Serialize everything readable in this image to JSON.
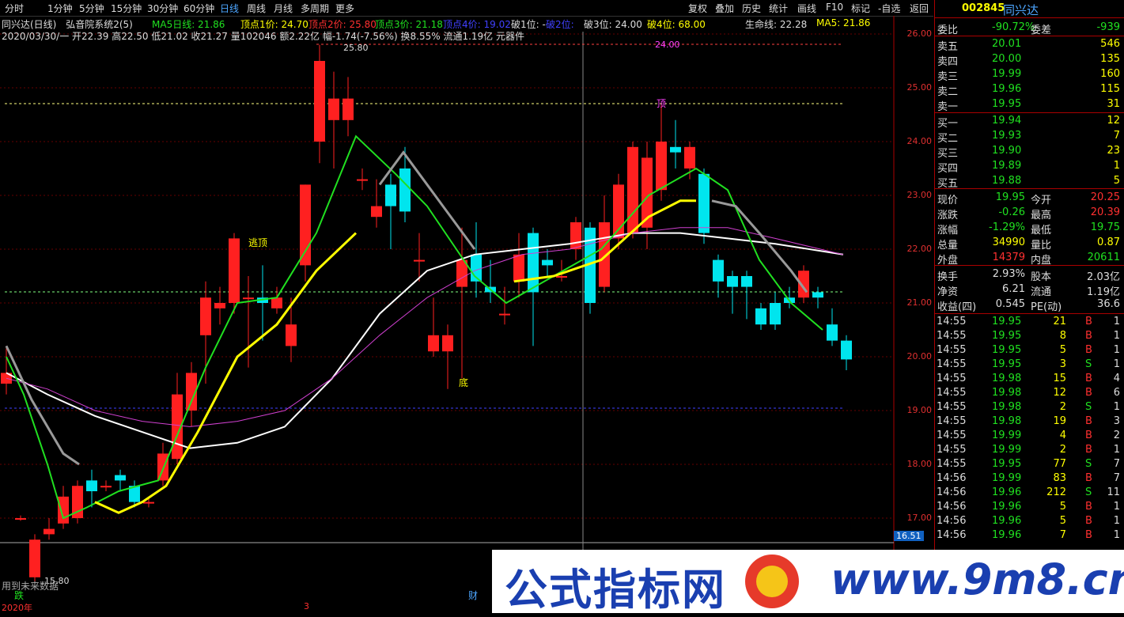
{
  "toolbar": {
    "tabs": [
      "分时",
      "1分钟",
      "5分钟",
      "15分钟",
      "30分钟",
      "60分钟",
      "日线",
      "周线",
      "月线",
      "多周期",
      "更多"
    ],
    "active": "日线",
    "right_buttons": [
      "复权",
      "叠加",
      "历史",
      "统计",
      "画线",
      "F10",
      "标记",
      "-自选",
      "返回"
    ]
  },
  "chart_header": {
    "title": "同兴达(日线)",
    "indicator": "弘音院系统2(5)",
    "ma5": "MA5日线: 21.86",
    "top1": "顶点1价: 24.70",
    "top2": "顶点2价: 25.80",
    "top3": "顶点3价: 21.18",
    "top4": "顶点4价: 19.02",
    "break1": "破1位: -",
    "break2": "破2位:",
    "break3": "破3位: 24.00",
    "break4": "破4位: 68.00",
    "lifeline": "生命线: 22.28",
    "ma5b": "MA5: 21.86"
  },
  "quote_line": "2020/03/30/一 开22.39 高22.50 低21.02 收21.27 量102046 额2.22亿 幅-1.74(-7.56%) 换8.55% 流通1.19亿 元器件",
  "chart_labels": {
    "escape_top": "逃顶",
    "bottom": "底",
    "high": "25.80",
    "low": "15.80",
    "top_mark": "顶",
    "current_price_tag": "16.51",
    "future_note": "用到未来数据",
    "x_year": "2020年",
    "x_month": "3",
    "die_tag": "跌",
    "cai_tag": "财",
    "top_price_mark": "24.00"
  },
  "price_axis": [
    "26.00",
    "25.00",
    "24.00",
    "23.00",
    "22.00",
    "21.00",
    "20.00",
    "19.00",
    "18.00",
    "17.00"
  ],
  "quote_panel": {
    "code": "002845",
    "name": "同兴达",
    "weibi_label": "委比",
    "weibi": "-90.72%",
    "weicha_label": "委差",
    "weicha": "-939",
    "asks": [
      {
        "label": "卖五",
        "price": "20.01",
        "vol": "546"
      },
      {
        "label": "卖四",
        "price": "20.00",
        "vol": "135"
      },
      {
        "label": "卖三",
        "price": "19.99",
        "vol": "160"
      },
      {
        "label": "卖二",
        "price": "19.96",
        "vol": "115"
      },
      {
        "label": "卖一",
        "price": "19.95",
        "vol": "31"
      }
    ],
    "bids": [
      {
        "label": "买一",
        "price": "19.94",
        "vol": "12"
      },
      {
        "label": "买二",
        "price": "19.93",
        "vol": "7"
      },
      {
        "label": "买三",
        "price": "19.90",
        "vol": "23"
      },
      {
        "label": "买四",
        "price": "19.89",
        "vol": "1"
      },
      {
        "label": "买五",
        "price": "19.88",
        "vol": "5"
      }
    ],
    "stats": [
      {
        "l1": "现价",
        "v1": "19.95",
        "l2": "今开",
        "v2": "20.25",
        "c1": "#20e020",
        "c2": "#ff3030"
      },
      {
        "l1": "涨跌",
        "v1": "-0.26",
        "l2": "最高",
        "v2": "20.39",
        "c1": "#20e020",
        "c2": "#ff3030"
      },
      {
        "l1": "涨幅",
        "v1": "-1.29%",
        "l2": "最低",
        "v2": "19.75",
        "c1": "#20e020",
        "c2": "#20e020"
      },
      {
        "l1": "总量",
        "v1": "34990",
        "l2": "量比",
        "v2": "0.87",
        "c1": "#ffff00",
        "c2": "#ffff00"
      },
      {
        "l1": "外盘",
        "v1": "14379",
        "l2": "内盘",
        "v2": "20611",
        "c1": "#ff3030",
        "c2": "#20e020"
      }
    ],
    "stats2": [
      {
        "l1": "换手",
        "v1": "2.93%",
        "l2": "股本",
        "v2": "2.03亿"
      },
      {
        "l1": "净资",
        "v1": "6.21",
        "l2": "流通",
        "v2": "1.19亿"
      },
      {
        "l1": "收益(四)",
        "v1": "0.545",
        "l2": "PE(动)",
        "v2": "36.6"
      }
    ],
    "ticks": [
      {
        "t": "14:55",
        "p": "19.95",
        "v": "21",
        "s": "B",
        "n": "1"
      },
      {
        "t": "14:55",
        "p": "19.95",
        "v": "8",
        "s": "B",
        "n": "1"
      },
      {
        "t": "14:55",
        "p": "19.95",
        "v": "5",
        "s": "B",
        "n": "1"
      },
      {
        "t": "14:55",
        "p": "19.95",
        "v": "3",
        "s": "S",
        "n": "1"
      },
      {
        "t": "14:55",
        "p": "19.98",
        "v": "15",
        "s": "B",
        "n": "4"
      },
      {
        "t": "14:55",
        "p": "19.98",
        "v": "12",
        "s": "B",
        "n": "6"
      },
      {
        "t": "14:55",
        "p": "19.98",
        "v": "2",
        "s": "S",
        "n": "1"
      },
      {
        "t": "14:55",
        "p": "19.98",
        "v": "19",
        "s": "B",
        "n": "3"
      },
      {
        "t": "14:55",
        "p": "19.99",
        "v": "4",
        "s": "B",
        "n": "2"
      },
      {
        "t": "14:55",
        "p": "19.99",
        "v": "2",
        "s": "B",
        "n": "1"
      },
      {
        "t": "14:55",
        "p": "19.95",
        "v": "77",
        "s": "S",
        "n": "7"
      },
      {
        "t": "14:56",
        "p": "19.99",
        "v": "83",
        "s": "B",
        "n": "7"
      },
      {
        "t": "14:56",
        "p": "19.96",
        "v": "212",
        "s": "S",
        "n": "11"
      },
      {
        "t": "14:56",
        "p": "19.96",
        "v": "5",
        "s": "B",
        "n": "1"
      },
      {
        "t": "14:56",
        "p": "19.96",
        "v": "5",
        "s": "B",
        "n": "1"
      },
      {
        "t": "14:56",
        "p": "19.96",
        "v": "7",
        "s": "B",
        "n": "1"
      }
    ]
  },
  "watermark": {
    "text": "公式指标网",
    "url": "www.9m8.cn"
  },
  "colors": {
    "up": "#ff2020",
    "down": "#00e5ee",
    "ma": "#ffffff",
    "yellow": "#ffff00",
    "green": "#20e020"
  }
}
